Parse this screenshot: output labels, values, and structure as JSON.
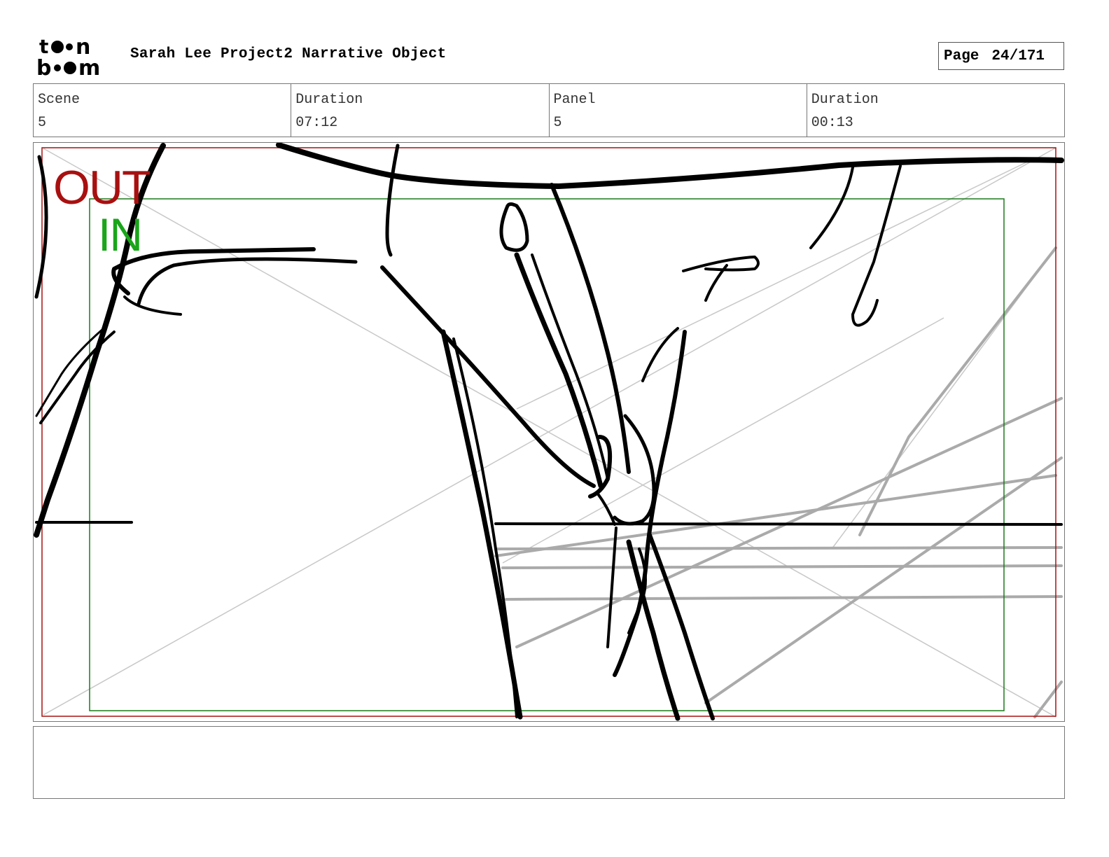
{
  "header": {
    "logo_text": "toon boom",
    "project_title": "Sarah Lee Project2 Narrative Object",
    "page_label": "Page",
    "page_number": "24/171"
  },
  "info": {
    "scene_label": "Scene",
    "scene_value": "5",
    "scene_duration_label": "Duration",
    "scene_duration_value": "07:12",
    "panel_label": "Panel",
    "panel_value": "5",
    "panel_duration_label": "Duration",
    "panel_duration_value": "00:13"
  },
  "frame": {
    "out_label": "OUT",
    "in_label": "IN",
    "out_color": "#a81010",
    "in_color": "#1aa51a"
  },
  "dialogue": {
    "text": ""
  }
}
